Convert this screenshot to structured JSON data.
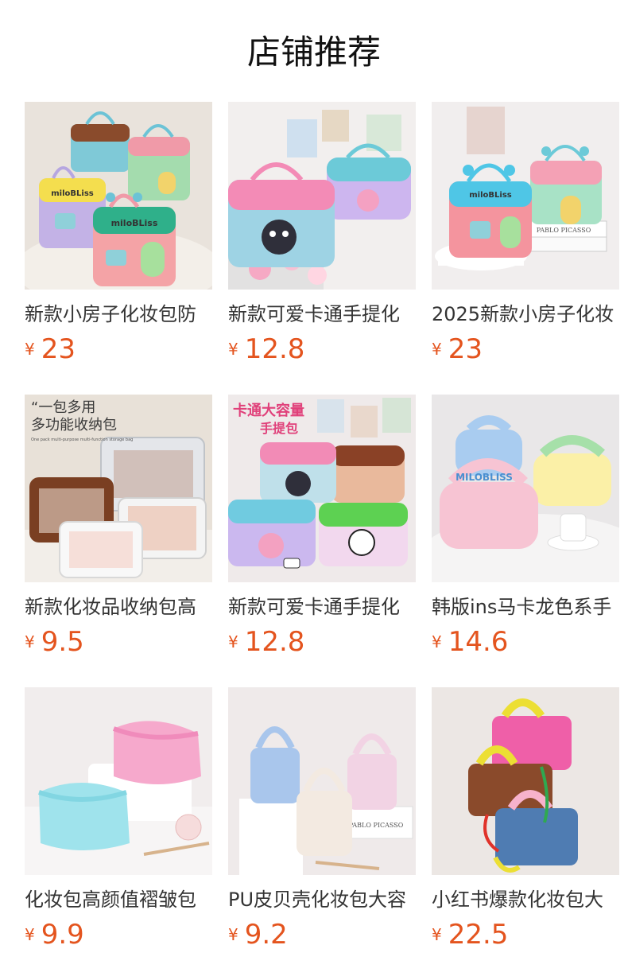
{
  "page": {
    "title": "店铺推荐"
  },
  "currency": "¥",
  "products": [
    {
      "name": "新款小房子化妆包防",
      "price": "23",
      "brand": "miloBLiss"
    },
    {
      "name": "新款可爱卡通手提化",
      "price": "12.8"
    },
    {
      "name": "2025新款小房子化妆",
      "price": "23",
      "brand": "miloBLiss"
    },
    {
      "name": "新款化妆品收纳包高",
      "price": "9.5",
      "overlay_lines": [
        "“一包多用",
        "多功能收纳包"
      ],
      "overlay_small": "One pack multi-purpose multi-function storage bag"
    },
    {
      "name": "新款可爱卡通手提化",
      "price": "12.8",
      "overlay_lines": [
        "卡通大容量",
        "手提包"
      ]
    },
    {
      "name": "韩版ins马卡龙色系手",
      "price": "14.6",
      "brand": "MILOBLISS"
    },
    {
      "name": "化妆包高颜值褶皱包",
      "price": "9.9"
    },
    {
      "name": "PU皮贝壳化妆包大容",
      "price": "9.2",
      "book_text": "PABLO PICASSO"
    },
    {
      "name": "小红书爆款化妆包大",
      "price": "22.5"
    }
  ],
  "colors": {
    "price": "#e4541e",
    "title": "#111111",
    "name": "#333333"
  }
}
